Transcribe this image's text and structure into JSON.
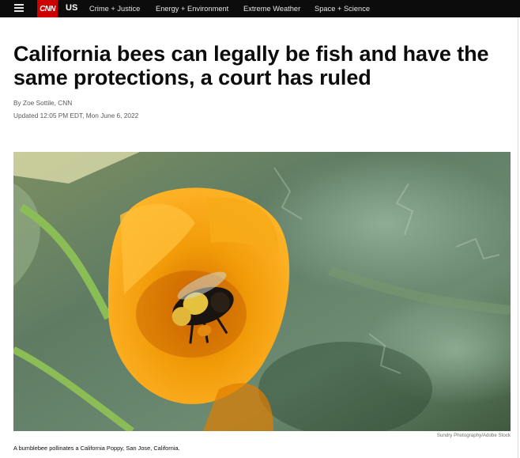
{
  "nav": {
    "menu_icon": "hamburger-menu-icon",
    "logo": "CNN",
    "section": "US",
    "links": [
      "Crime + Justice",
      "Energy + Environment",
      "Extreme Weather",
      "Space + Science"
    ]
  },
  "article": {
    "headline": "California bees can legally be fish and have the same protections, a court has ruled",
    "byline_prefix": "By ",
    "author": "Zoe Sottile",
    "byline_suffix": ", CNN",
    "updated": "Updated 12:05 PM EDT, Mon June 6, 2022"
  },
  "hero": {
    "credit": "Sundry Photography/Adobe Stock",
    "caption": "A bumblebee pollinates a California Poppy, San Jose, California."
  },
  "colors": {
    "brand_red": "#cc0000",
    "nav_bg": "#0c0c0c",
    "poppy": "#f5a000"
  }
}
